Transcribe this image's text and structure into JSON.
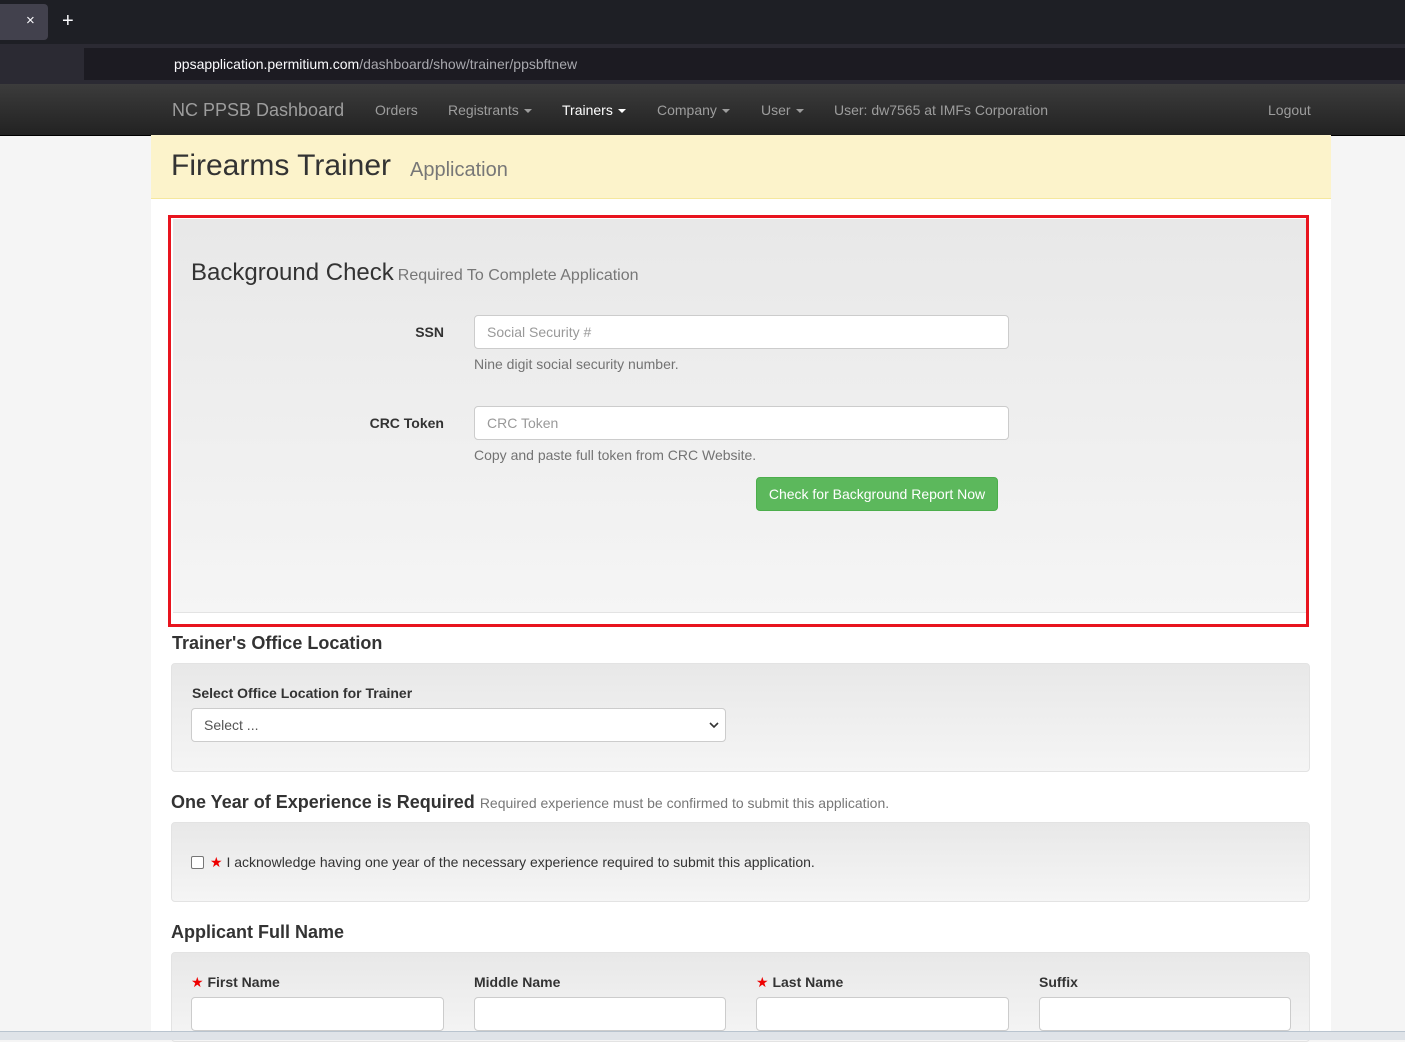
{
  "browser": {
    "tab_close": "×",
    "new_tab": "+",
    "url_host": "ppsapplication.permitium.com",
    "url_path": "/dashboard/show/trainer/ppsbftnew"
  },
  "navbar": {
    "brand": "NC PPSB Dashboard",
    "items": [
      {
        "label": "Orders"
      },
      {
        "label": "Registrants"
      },
      {
        "label": "Trainers"
      },
      {
        "label": "Company"
      },
      {
        "label": "User"
      }
    ],
    "user_info": "User: dw7565 at IMFs Corporation",
    "logout": "Logout"
  },
  "header": {
    "title": "Firearms Trainer",
    "subtitle": "Application"
  },
  "background_check": {
    "title": "Background Check",
    "subtitle": "Required To Complete Application",
    "ssn_label": "SSN",
    "ssn_placeholder": "Social Security #",
    "ssn_help": "Nine digit social security number.",
    "crc_label": "CRC Token",
    "crc_placeholder": "CRC Token",
    "crc_help": "Copy and paste full token from CRC Website.",
    "check_button": "Check for Background Report Now"
  },
  "office_location": {
    "title": "Trainer's Office Location",
    "select_label": "Select Office Location for Trainer",
    "select_value": "Select ..."
  },
  "experience": {
    "title": "One Year of Experience is Required",
    "subtitle": "Required experience must be confirmed to submit this application.",
    "required_mark": "★",
    "ack_text": "I acknowledge having one year of the necessary experience required to submit this application."
  },
  "full_name": {
    "title": "Applicant Full Name",
    "required_mark": "★",
    "first_label": "First Name",
    "middle_label": "Middle Name",
    "last_label": "Last Name",
    "suffix_label": "Suffix"
  },
  "colors": {
    "highlight": "#e8141e",
    "success": "#5cb85c",
    "jumbotron": "#fcf3cb",
    "required": "#ee0000"
  }
}
